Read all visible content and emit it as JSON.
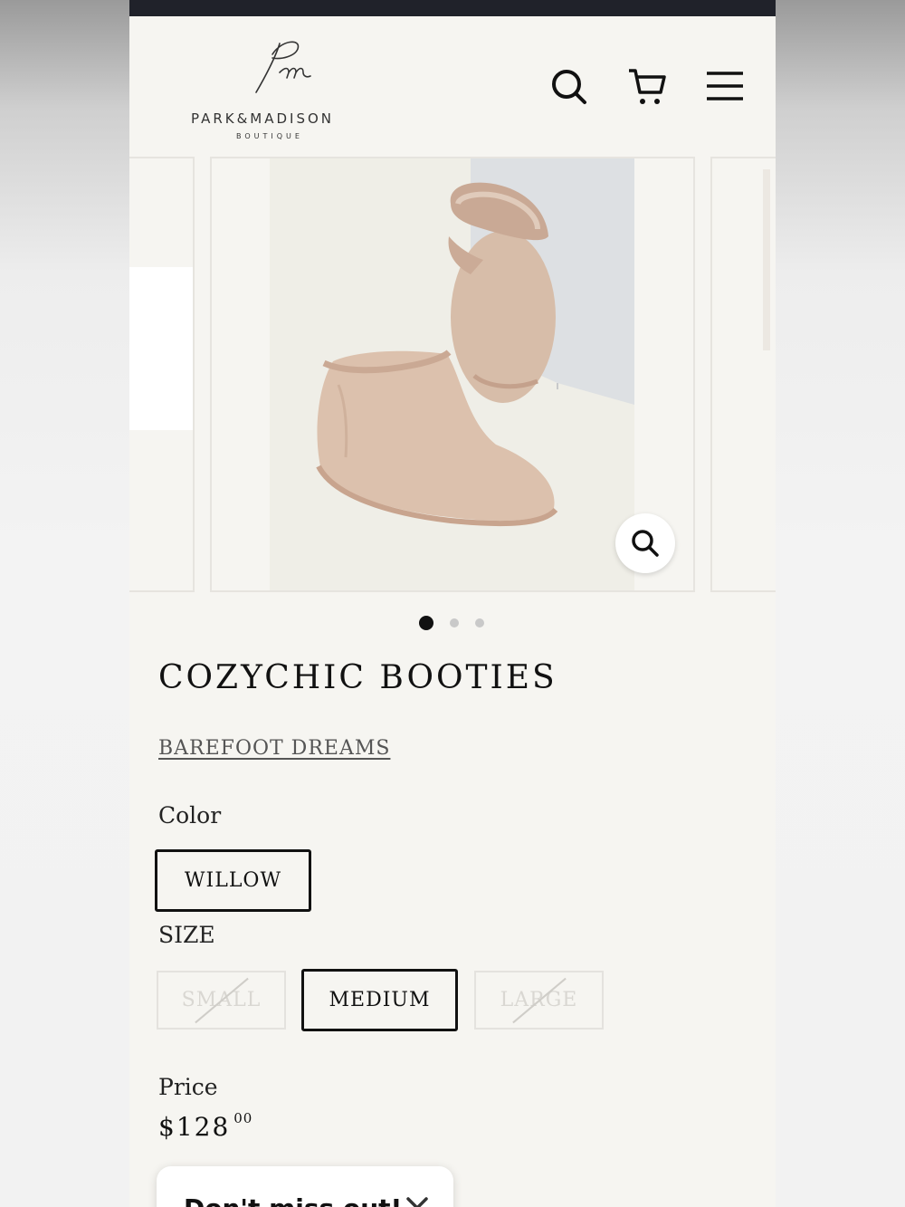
{
  "header": {
    "brand_name": "PARK&MADISON",
    "brand_sub": "BOUTIQUE",
    "icons": [
      "search-icon",
      "cart-icon",
      "menu-icon"
    ]
  },
  "gallery": {
    "slide_count": 3,
    "active_slide": 1,
    "zoom_icon": "zoom-icon"
  },
  "product": {
    "title": "COZYCHIC BOOTIES",
    "vendor": "BAREFOOT DREAMS",
    "color_label": "Color",
    "color_options": [
      "WILLOW"
    ],
    "color_selected": "WILLOW",
    "size_label": "SIZE",
    "size_options": [
      {
        "label": "SMALL",
        "available": false
      },
      {
        "label": "MEDIUM",
        "available": true,
        "selected": true
      },
      {
        "label": "LARGE",
        "available": false
      }
    ],
    "price_label": "Price",
    "price_main": "$128",
    "price_cents": "00"
  },
  "popup": {
    "text": "Don't miss out!",
    "close_icon": "close-icon"
  },
  "colors": {
    "page_bg": "#f6f5f1",
    "topbar": "#20222a",
    "slipper": "#d9c0ad",
    "text": "#111111"
  }
}
